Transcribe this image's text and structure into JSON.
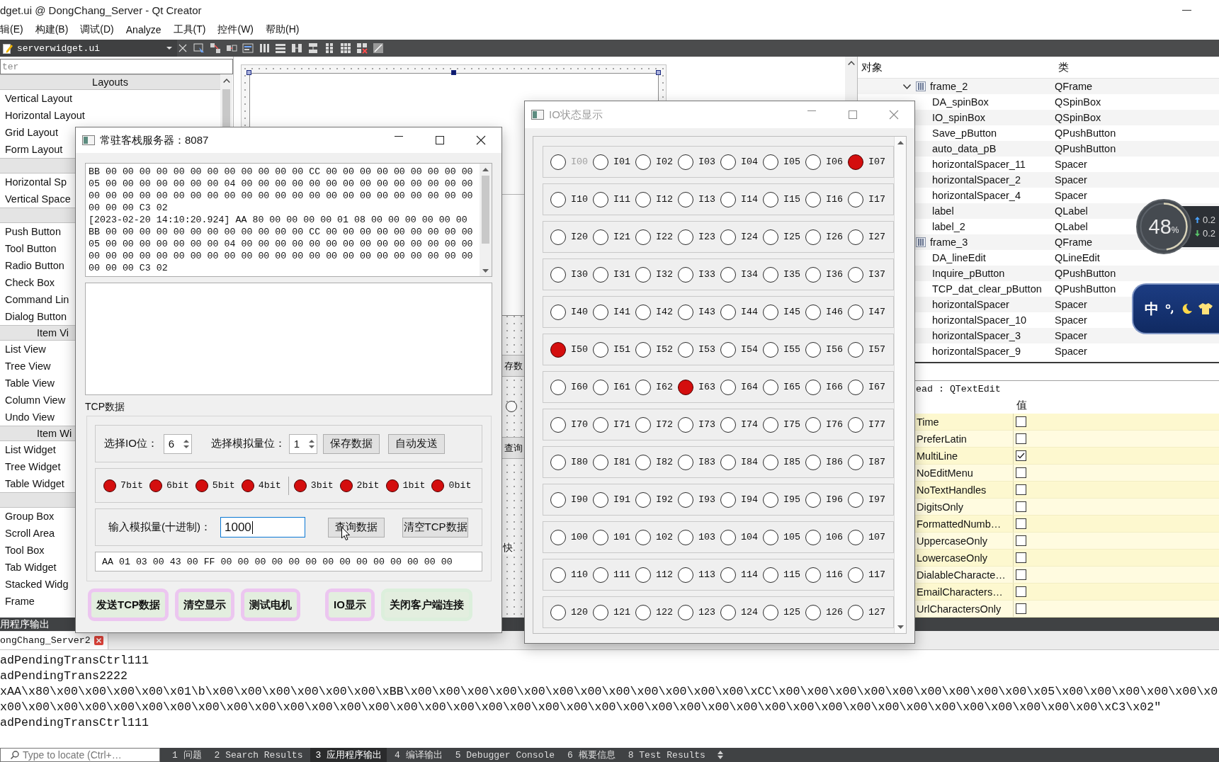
{
  "window": {
    "title": "dget.ui @ DongChang_Server - Qt Creator"
  },
  "menu": [
    "辑(E)",
    "构建(B)",
    "调试(D)",
    "Analyze",
    "工具(T)",
    "控件(W)",
    "帮助(H)"
  ],
  "editor_toolbar": {
    "file": "serverwidget.ui"
  },
  "widget_box": {
    "filter_placeholder": "ter",
    "categories": [
      {
        "title": "Layouts",
        "items": [
          "Vertical Layout",
          "Horizontal Layout",
          "Grid Layout",
          "Form Layout"
        ]
      },
      {
        "items": [
          "Horizontal Sp",
          "Vertical Space"
        ]
      },
      {
        "items": [
          "Push Button",
          "Tool Button",
          "Radio Button",
          "Check Box",
          "Command Lin",
          "Dialog Button"
        ]
      },
      {
        "title": "Item Vi",
        "items": [
          "List View",
          "Tree View",
          "Table View",
          "Column View",
          "Undo View"
        ]
      },
      {
        "title": "Item Wi",
        "items": [
          "List Widget",
          "Tree Widget",
          "Table Widget"
        ]
      },
      {
        "items": [
          "Group Box",
          "Scroll Area",
          "Tool Box",
          "Tab Widget",
          "Stacked Widg",
          "Frame"
        ]
      }
    ]
  },
  "form_preview": {
    "parts": [
      {
        "kind": "button",
        "text": "存数"
      },
      {
        "kind": "radio",
        "checked": false
      },
      {
        "kind": "button",
        "text": "查询"
      },
      {
        "kind": "label",
        "text": "快"
      }
    ]
  },
  "object_inspector": {
    "columns": [
      "对象",
      "类"
    ],
    "items": [
      {
        "name": "frame_2",
        "class": "QFrame",
        "expanded": true,
        "children": [
          {
            "name": "DA_spinBox",
            "class": "QSpinBox"
          },
          {
            "name": "IO_spinBox",
            "class": "QSpinBox"
          },
          {
            "name": "Save_pButton",
            "class": "QPushButton"
          },
          {
            "name": "auto_data_pB",
            "class": "QPushButton"
          },
          {
            "name": "horizontalSpacer_11",
            "class": "Spacer"
          },
          {
            "name": "horizontalSpacer_2",
            "class": "Spacer"
          },
          {
            "name": "horizontalSpacer_4",
            "class": "Spacer"
          },
          {
            "name": "label",
            "class": "QLabel"
          },
          {
            "name": "label_2",
            "class": "QLabel"
          }
        ]
      },
      {
        "name": "frame_3",
        "class": "QFrame",
        "children": [
          {
            "name": "DA_lineEdit",
            "class": "QLineEdit"
          },
          {
            "name": "Inquire_pButton",
            "class": "QPushButton"
          },
          {
            "name": "TCP_dat_clear_pButton",
            "class": "QPushButton"
          },
          {
            "name": "horizontalSpacer",
            "class": "Spacer"
          },
          {
            "name": "horizontalSpacer_10",
            "class": "Spacer"
          },
          {
            "name": "horizontalSpacer_3",
            "class": "Spacer"
          },
          {
            "name": "horizontalSpacer_9",
            "class": "Spacer"
          }
        ]
      }
    ]
  },
  "property_editor": {
    "object": "ead : QTextEdit",
    "value_column": "值",
    "properties": [
      {
        "name": "Time",
        "checked": false
      },
      {
        "name": "PreferLatin",
        "checked": false
      },
      {
        "name": "MultiLine",
        "checked": true
      },
      {
        "name": "NoEditMenu",
        "checked": false
      },
      {
        "name": "NoTextHandles",
        "checked": false
      },
      {
        "name": "DigitsOnly",
        "checked": false
      },
      {
        "name": "FormattedNumb…",
        "checked": false
      },
      {
        "name": "UppercaseOnly",
        "checked": false
      },
      {
        "name": "LowercaseOnly",
        "checked": false
      },
      {
        "name": "DialableCharacte…",
        "checked": false
      },
      {
        "name": "EmailCharacters…",
        "checked": false
      },
      {
        "name": "UrlCharactersOnly",
        "checked": false
      }
    ]
  },
  "server_dialog": {
    "title": "常驻客栈服务器：8087",
    "active": true,
    "log": [
      "BB 00 00 00 00 00 00 00 00 00 00 00 00 CC 00 00 00 00 00 00 00 00 00",
      "05 00 00 00 00 00 00 00 04 00 00 00 00 00 00 00 00 00 00 00 00 00 00",
      "00 00 00 00 00 00 00 00 00 00 00 00 00 00 00 00 00 00 00 00 00 00 00",
      "00 00 00 C3 02",
      "[2023-02-20 14:10:20.924] AA 80 00 00 00 00 01 08 00 00 00 00 00 00",
      "BB 00 00 00 00 00 00 00 00 00 00 00 00 CC 00 00 00 00 00 00 00 00 00",
      "05 00 00 00 00 00 00 00 04 00 00 00 00 00 00 00 00 00 00 00 00 00 00",
      "00 00 00 00 00 00 00 00 00 00 00 00 00 00 00 00 00 00 00 00 00 00 00",
      "00 00 00 C3 02"
    ],
    "section_label": "TCP数据",
    "io_select": {
      "label": "选择IO位：",
      "value": "6"
    },
    "analog_select": {
      "label": "选择模拟量位：",
      "value": "1"
    },
    "select_buttons": [
      "保存数据",
      "自动发送"
    ],
    "bit_groups": [
      [
        {
          "label": "7bit",
          "on": true
        },
        {
          "label": "6bit",
          "on": true
        },
        {
          "label": "5bit",
          "on": true
        },
        {
          "label": "4bit",
          "on": true
        }
      ],
      [
        {
          "label": "3bit",
          "on": true
        },
        {
          "label": "2bit",
          "on": true
        },
        {
          "label": "1bit",
          "on": true
        },
        {
          "label": "0bit",
          "on": true
        }
      ]
    ],
    "analog_input": {
      "label": "输入模拟量(十进制)：",
      "value": "1000",
      "focused": true
    },
    "input_buttons": [
      "查询数据",
      "清空TCP数据"
    ],
    "frame_preview": "AA 01 03 00 43 00 FF 00 00 00 00 00 00 00 00 00 00 00 00 00 00",
    "button_groups": [
      [
        {
          "label": "发送TCP数据",
          "color": "#ecc6f0"
        },
        {
          "label": "清空显示",
          "color": "#ecc6f0"
        },
        {
          "label": "测试电机",
          "color": "#ecc6f0"
        }
      ],
      [
        {
          "label": "IO显示",
          "color": "#ecc6f0"
        },
        {
          "label": "关闭客户端连接",
          "color": "#dcefdc"
        }
      ]
    ]
  },
  "io_dialog": {
    "title": "IO状态显示",
    "active": false,
    "rows": [
      [
        {
          "label": "I00",
          "on": false,
          "disabled": true
        },
        {
          "label": "I01",
          "on": false,
          "disabled": false
        },
        {
          "label": "I02",
          "on": false,
          "disabled": false
        },
        {
          "label": "I03",
          "on": false,
          "disabled": false
        },
        {
          "label": "I04",
          "on": false,
          "disabled": false
        },
        {
          "label": "I05",
          "on": false,
          "disabled": false
        },
        {
          "label": "I06",
          "on": false,
          "disabled": false
        },
        {
          "label": "I07",
          "on": true,
          "disabled": false
        }
      ],
      [
        {
          "label": "I10",
          "on": false,
          "disabled": false
        },
        {
          "label": "I11",
          "on": false,
          "disabled": false
        },
        {
          "label": "I12",
          "on": false,
          "disabled": false
        },
        {
          "label": "I13",
          "on": false,
          "disabled": false
        },
        {
          "label": "I14",
          "on": false,
          "disabled": false
        },
        {
          "label": "I15",
          "on": false,
          "disabled": false
        },
        {
          "label": "I16",
          "on": false,
          "disabled": false
        },
        {
          "label": "I17",
          "on": false,
          "disabled": false
        }
      ],
      [
        {
          "label": "I20",
          "on": false,
          "disabled": false
        },
        {
          "label": "I21",
          "on": false,
          "disabled": false
        },
        {
          "label": "I22",
          "on": false,
          "disabled": false
        },
        {
          "label": "I23",
          "on": false,
          "disabled": false
        },
        {
          "label": "I24",
          "on": false,
          "disabled": false
        },
        {
          "label": "I25",
          "on": false,
          "disabled": false
        },
        {
          "label": "I26",
          "on": false,
          "disabled": false
        },
        {
          "label": "I27",
          "on": false,
          "disabled": false
        }
      ],
      [
        {
          "label": "I30",
          "on": false,
          "disabled": false
        },
        {
          "label": "I31",
          "on": false,
          "disabled": false
        },
        {
          "label": "I32",
          "on": false,
          "disabled": false
        },
        {
          "label": "I33",
          "on": false,
          "disabled": false
        },
        {
          "label": "I34",
          "on": false,
          "disabled": false
        },
        {
          "label": "I35",
          "on": false,
          "disabled": false
        },
        {
          "label": "I36",
          "on": false,
          "disabled": false
        },
        {
          "label": "I37",
          "on": false,
          "disabled": false
        }
      ],
      [
        {
          "label": "I40",
          "on": false,
          "disabled": false
        },
        {
          "label": "I41",
          "on": false,
          "disabled": false
        },
        {
          "label": "I42",
          "on": false,
          "disabled": false
        },
        {
          "label": "I43",
          "on": false,
          "disabled": false
        },
        {
          "label": "I44",
          "on": false,
          "disabled": false
        },
        {
          "label": "I45",
          "on": false,
          "disabled": false
        },
        {
          "label": "I46",
          "on": false,
          "disabled": false
        },
        {
          "label": "I47",
          "on": false,
          "disabled": false
        }
      ],
      [
        {
          "label": "I50",
          "on": true,
          "disabled": false
        },
        {
          "label": "I51",
          "on": false,
          "disabled": false
        },
        {
          "label": "I52",
          "on": false,
          "disabled": false
        },
        {
          "label": "I53",
          "on": false,
          "disabled": false
        },
        {
          "label": "I54",
          "on": false,
          "disabled": false
        },
        {
          "label": "I55",
          "on": false,
          "disabled": false
        },
        {
          "label": "I56",
          "on": false,
          "disabled": false
        },
        {
          "label": "I57",
          "on": false,
          "disabled": false
        }
      ],
      [
        {
          "label": "I60",
          "on": false,
          "disabled": false
        },
        {
          "label": "I61",
          "on": false,
          "disabled": false
        },
        {
          "label": "I62",
          "on": false,
          "disabled": false
        },
        {
          "label": "I63",
          "on": true,
          "disabled": false
        },
        {
          "label": "I64",
          "on": false,
          "disabled": false
        },
        {
          "label": "I65",
          "on": false,
          "disabled": false
        },
        {
          "label": "I66",
          "on": false,
          "disabled": false
        },
        {
          "label": "I67",
          "on": false,
          "disabled": false
        }
      ],
      [
        {
          "label": "I70",
          "on": false,
          "disabled": false
        },
        {
          "label": "I71",
          "on": false,
          "disabled": false
        },
        {
          "label": "I72",
          "on": false,
          "disabled": false
        },
        {
          "label": "I73",
          "on": false,
          "disabled": false
        },
        {
          "label": "I74",
          "on": false,
          "disabled": false
        },
        {
          "label": "I75",
          "on": false,
          "disabled": false
        },
        {
          "label": "I76",
          "on": false,
          "disabled": false
        },
        {
          "label": "I77",
          "on": false,
          "disabled": false
        }
      ],
      [
        {
          "label": "I80",
          "on": false,
          "disabled": false
        },
        {
          "label": "I81",
          "on": false,
          "disabled": false
        },
        {
          "label": "I82",
          "on": false,
          "disabled": false
        },
        {
          "label": "I83",
          "on": false,
          "disabled": false
        },
        {
          "label": "I84",
          "on": false,
          "disabled": false
        },
        {
          "label": "I85",
          "on": false,
          "disabled": false
        },
        {
          "label": "I86",
          "on": false,
          "disabled": false
        },
        {
          "label": "I87",
          "on": false,
          "disabled": false
        }
      ],
      [
        {
          "label": "I90",
          "on": false,
          "disabled": false
        },
        {
          "label": "I91",
          "on": false,
          "disabled": false
        },
        {
          "label": "I92",
          "on": false,
          "disabled": false
        },
        {
          "label": "I93",
          "on": false,
          "disabled": false
        },
        {
          "label": "I94",
          "on": false,
          "disabled": false
        },
        {
          "label": "I95",
          "on": false,
          "disabled": false
        },
        {
          "label": "I96",
          "on": false,
          "disabled": false
        },
        {
          "label": "I97",
          "on": false,
          "disabled": false
        }
      ],
      [
        {
          "label": "100",
          "on": false,
          "disabled": false
        },
        {
          "label": "101",
          "on": false,
          "disabled": false
        },
        {
          "label": "102",
          "on": false,
          "disabled": false
        },
        {
          "label": "103",
          "on": false,
          "disabled": false
        },
        {
          "label": "104",
          "on": false,
          "disabled": false
        },
        {
          "label": "105",
          "on": false,
          "disabled": false
        },
        {
          "label": "106",
          "on": false,
          "disabled": false
        },
        {
          "label": "107",
          "on": false,
          "disabled": false
        }
      ],
      [
        {
          "label": "110",
          "on": false,
          "disabled": false
        },
        {
          "label": "111",
          "on": false,
          "disabled": false
        },
        {
          "label": "112",
          "on": false,
          "disabled": false
        },
        {
          "label": "113",
          "on": false,
          "disabled": false
        },
        {
          "label": "114",
          "on": false,
          "disabled": false
        },
        {
          "label": "115",
          "on": false,
          "disabled": false
        },
        {
          "label": "116",
          "on": false,
          "disabled": false
        },
        {
          "label": "117",
          "on": false,
          "disabled": false
        }
      ],
      [
        {
          "label": "120",
          "on": false,
          "disabled": false
        },
        {
          "label": "121",
          "on": false,
          "disabled": false
        },
        {
          "label": "122",
          "on": false,
          "disabled": false
        },
        {
          "label": "123",
          "on": false,
          "disabled": false
        },
        {
          "label": "124",
          "on": false,
          "disabled": false
        },
        {
          "label": "125",
          "on": false,
          "disabled": false
        },
        {
          "label": "126",
          "on": false,
          "disabled": false
        },
        {
          "label": "127",
          "on": false,
          "disabled": false
        }
      ]
    ]
  },
  "output_pane": {
    "title": "用程序输出",
    "tab": "ongChang_Server2",
    "lines": [
      "adPendingTransCtrl111",
      "adPendingTrans2222",
      "xAA\\x80\\x00\\x00\\x00\\x00\\x01\\b\\x00\\x00\\x00\\x00\\x00\\x00\\xBB\\x00\\x00\\x00\\x00\\x00\\x00\\x00\\x00\\x00\\x00\\x00\\x00\\xCC\\x00\\x00\\x00\\x00\\x00\\x00\\x00\\x00\\x00\\x05\\x00\\x00\\x00\\x00\\x00\\x0",
      "x00\\x00\\x00\\x00\\x00\\x00\\x00\\x00\\x00\\x00\\x00\\x00\\x00\\x00\\x00\\x00\\x00\\x00\\x00\\x00\\x00\\x00\\x00\\x00\\x00\\x00\\x00\\x00\\x00\\x00\\x00\\x00\\x00\\x00\\x00\\x00\\x00\\x00\\x00\\xC3\\x02\"",
      "adPendingTransCtrl111"
    ]
  },
  "status_bar": {
    "locator_placeholder": "Type to locate (Ctrl+…",
    "panes": [
      {
        "label": "1 问题",
        "selected": false
      },
      {
        "label": "2 Search Results",
        "selected": false
      },
      {
        "label": "3 应用程序输出",
        "selected": true
      },
      {
        "label": "4 编译输出",
        "selected": false
      },
      {
        "label": "5 Debugger Console",
        "selected": false
      },
      {
        "label": "6 概要信息",
        "selected": false
      },
      {
        "label": "8 Test Results",
        "selected": false
      }
    ]
  },
  "net_monitor": {
    "percent": "48",
    "unit": "%",
    "upload": "0.2",
    "download": "0.2"
  },
  "ime_bar": {
    "mode": "中"
  }
}
